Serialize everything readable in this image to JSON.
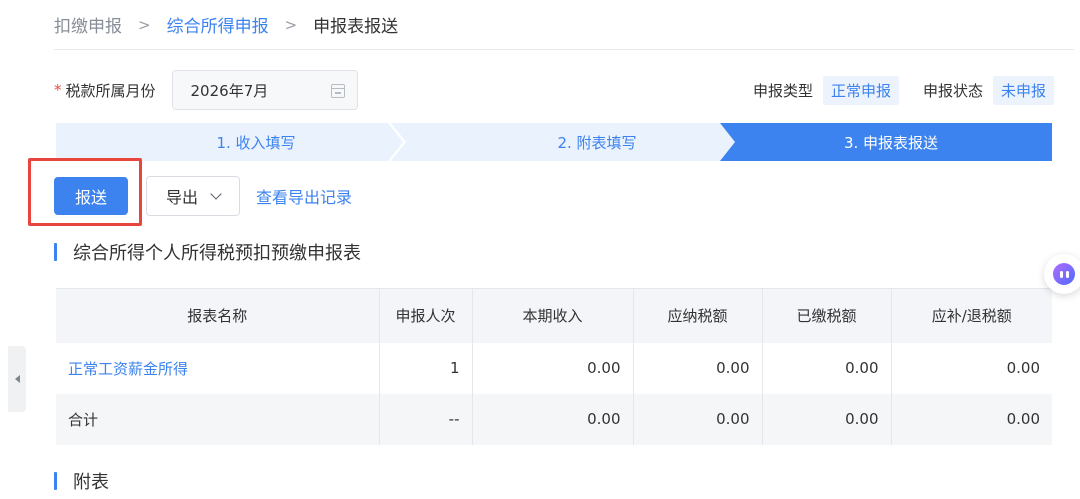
{
  "breadcrumb": {
    "root": "扣缴申报",
    "link": "综合所得申报",
    "current": "申报表报送",
    "separator": ">"
  },
  "form": {
    "required_mark": "*",
    "period_label": "税款所属月份",
    "period_value": "2026年7月",
    "filing_type_label": "申报类型",
    "filing_type_value": "正常申报",
    "filing_status_label": "申报状态",
    "filing_status_value": "未申报"
  },
  "steps": [
    {
      "label": "1. 收入填写",
      "state": "done"
    },
    {
      "label": "2. 附表填写",
      "state": "done"
    },
    {
      "label": "3. 申报表报送",
      "state": "active"
    }
  ],
  "actions": {
    "submit_label": "报送",
    "export_label": "导出",
    "records_link": "查看导出记录"
  },
  "report_section": {
    "title": "综合所得个人所得税预扣预缴申报表",
    "columns": [
      "报表名称",
      "申报人次",
      "本期收入",
      "应纳税额",
      "已缴税额",
      "应补/退税额"
    ],
    "rows": [
      {
        "name": "正常工资薪金所得",
        "count": "1",
        "income": "0.00",
        "tax_payable": "0.00",
        "tax_paid": "0.00",
        "tax_due": "0.00"
      },
      {
        "name": "合计",
        "count": "--",
        "income": "0.00",
        "tax_payable": "0.00",
        "tax_paid": "0.00",
        "tax_due": "0.00"
      }
    ]
  },
  "schedule_section": {
    "title": "附表"
  },
  "icons": {
    "calendar": "calendar-icon",
    "chevron": "chevron-down-icon",
    "collapse": "chevron-left-icon",
    "assistant": "assistant-bubble-icon"
  },
  "colors": {
    "accent": "#3c83ef",
    "highlight": "#e8463c",
    "required": "#f04a3e"
  }
}
